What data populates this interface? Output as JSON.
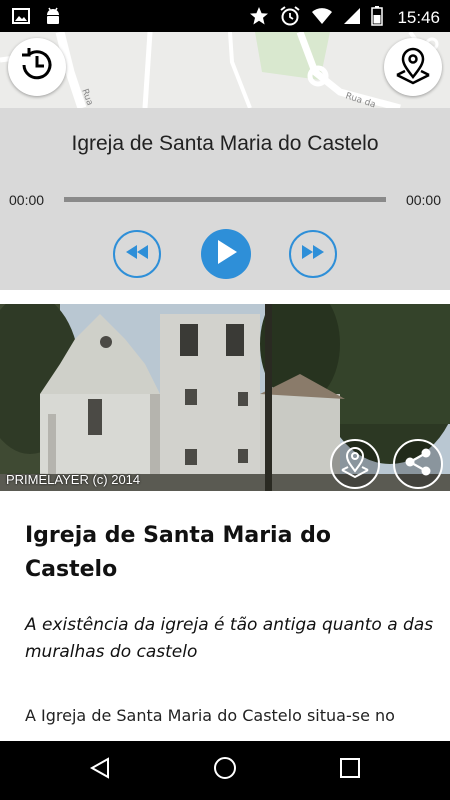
{
  "status_bar": {
    "time": "15:46",
    "left_icons": [
      "image-icon",
      "android-icon"
    ],
    "right_icons": [
      "star-icon",
      "alarm-icon",
      "wifi-icon",
      "signal-icon",
      "battery-icon"
    ]
  },
  "map": {
    "street_labels": [
      "Rua da Gra",
      "Rua da"
    ]
  },
  "player": {
    "title": "Igreja de Santa Maria do Castelo",
    "elapsed": "00:00",
    "duration": "00:00",
    "progress": 0,
    "accent_color": "#2e8fd8"
  },
  "photo": {
    "credit": "PRIMELAYER (c) 2014"
  },
  "article": {
    "title": "Igreja de Santa Maria do Castelo",
    "subtitle": "A existência da igreja é tão antiga quanto a das muralhas do castelo",
    "body": "A Igreja de Santa Maria do Castelo situa-se no"
  }
}
